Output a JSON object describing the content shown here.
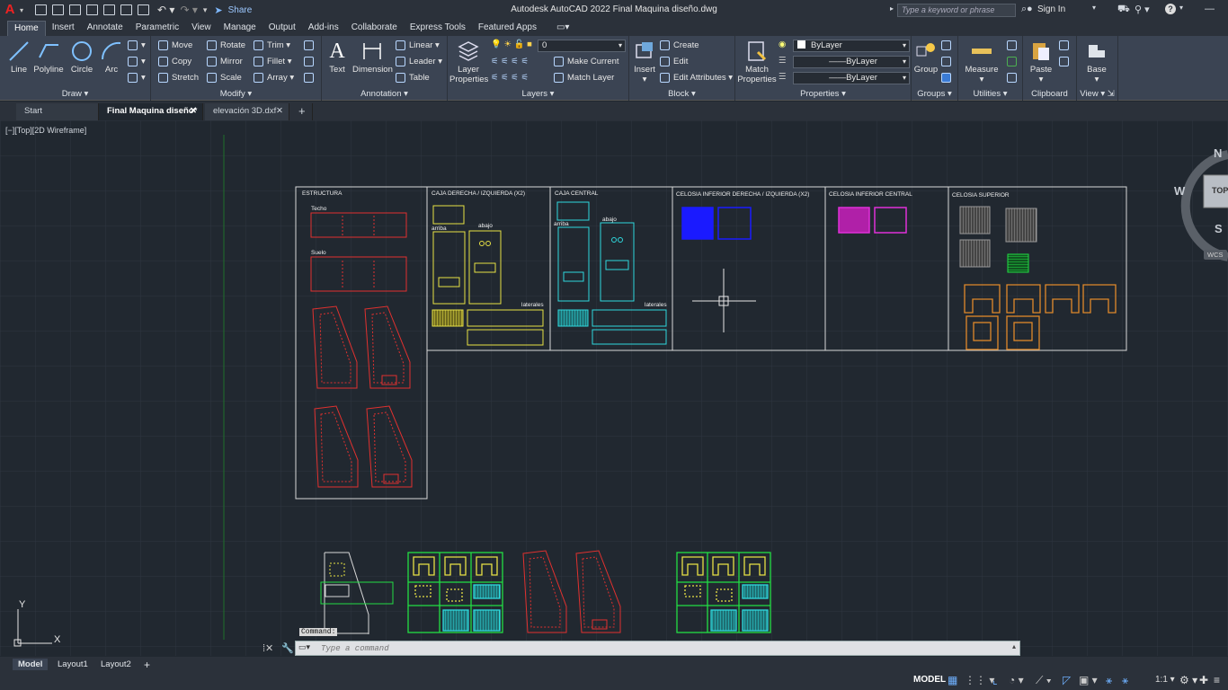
{
  "app": {
    "title": "Autodesk AutoCAD 2022    Final Maquina diseño.dwg",
    "logo": "A",
    "share": "Share",
    "search_placeholder": "Type a keyword or phrase",
    "signin": "Sign In"
  },
  "ribbon_tabs": [
    "Home",
    "Insert",
    "Annotate",
    "Parametric",
    "View",
    "Manage",
    "Output",
    "Add-ins",
    "Collaborate",
    "Express Tools",
    "Featured Apps"
  ],
  "ribbon": {
    "draw": {
      "title": "Draw",
      "line": "Line",
      "polyline": "Polyline",
      "circle": "Circle",
      "arc": "Arc"
    },
    "modify": {
      "title": "Modify",
      "move": "Move",
      "rotate": "Rotate",
      "trim": "Trim",
      "copy": "Copy",
      "mirror": "Mirror",
      "fillet": "Fillet",
      "stretch": "Stretch",
      "scale": "Scale",
      "array": "Array"
    },
    "annotation": {
      "title": "Annotation",
      "text": "Text",
      "dimension": "Dimension",
      "linear": "Linear",
      "leader": "Leader",
      "table": "Table"
    },
    "layers": {
      "title": "Layers",
      "layer_properties_1": "Layer",
      "layer_properties_2": "Properties",
      "current_layer": "0",
      "make_current": "Make Current",
      "match_layer": "Match Layer"
    },
    "block": {
      "title": "Block",
      "insert": "Insert",
      "create": "Create",
      "edit": "Edit",
      "edit_attributes": "Edit Attributes"
    },
    "properties": {
      "title": "Properties",
      "match_1": "Match",
      "match_2": "Properties",
      "color": "ByLayer",
      "linetype": "ByLayer",
      "lineweight": "ByLayer"
    },
    "groups": {
      "title": "Groups",
      "group": "Group"
    },
    "utilities": {
      "title": "Utilities",
      "measure": "Measure"
    },
    "clipboard": {
      "title": "Clipboard",
      "paste": "Paste"
    },
    "view": {
      "title": "View",
      "base": "Base"
    }
  },
  "file_tabs": [
    "Start",
    "Final Maquina diseño*",
    "elevación 3D.dxf"
  ],
  "viewport_label": "[−][Top][2D Wireframe]",
  "drawing": {
    "labels": {
      "estructura": "ESTRUCTURA",
      "techo": "Techo",
      "suelo": "Suelo",
      "caja_lateral": "CAJA DERECHA / IZQUIERDA (X2)",
      "arriba": "arriba",
      "abajo": "abajo",
      "laterales": "laterales",
      "caja_central": "CAJA CENTRAL",
      "arriba2": "arriba",
      "abajo2": "abajo",
      "laterales2": "laterales",
      "celosia_inf_lat": "CELOSIA  INFERIOR DERECHA / IZQUIERDA (X2)",
      "celosia_inf_central": "CELOSIA  INFERIOR CENTRAL",
      "celosia_superior": "CELOSIA SUPERIOR"
    },
    "ucs_x": "X",
    "ucs_y": "Y"
  },
  "viewcube": {
    "n": "N",
    "s": "S",
    "w": "W",
    "top": "TOP",
    "wcs": "WCS"
  },
  "command": {
    "tag": "Command:",
    "placeholder": "Type a command"
  },
  "layout_tabs": [
    "Model",
    "Layout1",
    "Layout2"
  ],
  "status": {
    "model": "MODEL",
    "scale": "1:1"
  },
  "colors": {
    "red": "#e1312f",
    "yellow": "#e8e245",
    "cyan": "#2fd9de",
    "blue": "#1a1aff",
    "magenta": "#e030d8",
    "orange": "#e0892a",
    "green": "#22dd44",
    "gray": "#9a9a9a"
  }
}
